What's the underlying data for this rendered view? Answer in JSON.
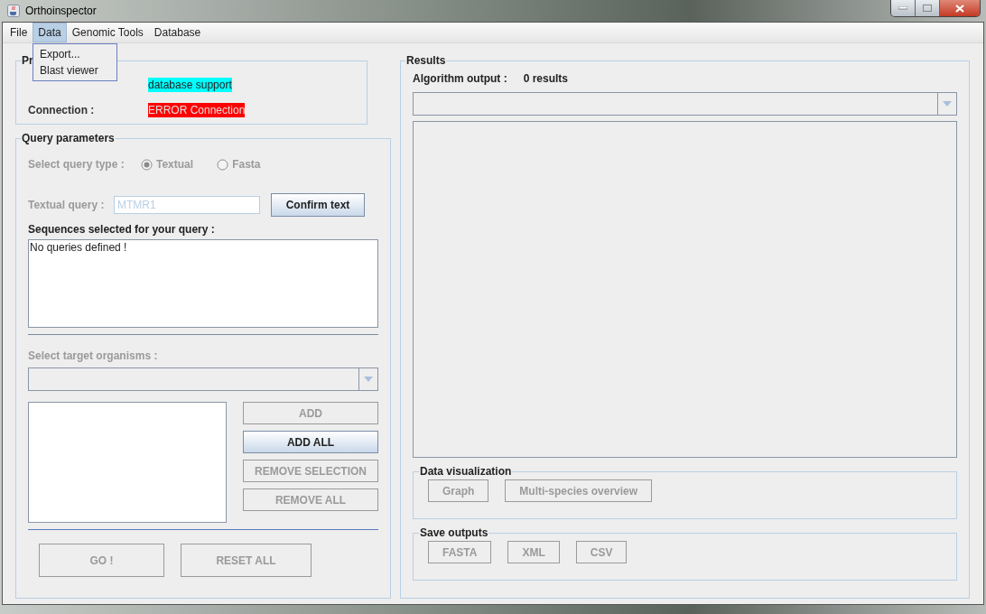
{
  "window": {
    "title": "Orthoinspector"
  },
  "menu": [
    {
      "label": "File",
      "selected": false
    },
    {
      "label": "Data",
      "selected": true
    },
    {
      "label": "Genomic Tools",
      "selected": false
    },
    {
      "label": "Database",
      "selected": false
    }
  ],
  "open_menu": {
    "items": [
      "Export...",
      "Blast viewer"
    ]
  },
  "profile": {
    "title": "Pr",
    "rows": [
      {
        "value": "database support",
        "color": "#00ffff"
      },
      {
        "label": "Connection :",
        "value": "ERROR Connection",
        "color": "#ff0000"
      }
    ]
  },
  "query": {
    "title": "Query parameters",
    "disabled": true,
    "query_type": {
      "label": "Select query type :",
      "options": [
        {
          "label": "Textual",
          "selected": true
        },
        {
          "label": "Fasta",
          "selected": false
        }
      ]
    },
    "textual_query": {
      "label": "Textual query :",
      "value": "MTMR1"
    },
    "confirm_button": {
      "label": "Confirm text",
      "disabled": false
    },
    "sequences": {
      "label": "Sequences selected for your query :",
      "text": "No queries defined !"
    },
    "targets": {
      "label": "Select target organisms :"
    },
    "list_buttons": [
      {
        "label": "ADD",
        "disabled": true
      },
      {
        "label": "ADD ALL",
        "disabled": false
      },
      {
        "label": "REMOVE SELECTION",
        "disabled": true
      },
      {
        "label": "REMOVE ALL",
        "disabled": true
      }
    ],
    "actions": [
      {
        "label": "GO !",
        "disabled": true
      },
      {
        "label": "RESET ALL",
        "disabled": true
      }
    ]
  },
  "results": {
    "title": "Results",
    "output_label": "Algorithm output :",
    "count": "0 results",
    "visualization": {
      "title": "Data visualization",
      "buttons": [
        {
          "label": "Graph",
          "disabled": true
        },
        {
          "label": "Multi-species overview",
          "disabled": true
        }
      ]
    },
    "save": {
      "title": "Save outputs",
      "buttons": [
        {
          "label": "FASTA",
          "disabled": true
        },
        {
          "label": "XML",
          "disabled": true
        },
        {
          "label": "CSV",
          "disabled": true
        }
      ]
    }
  }
}
